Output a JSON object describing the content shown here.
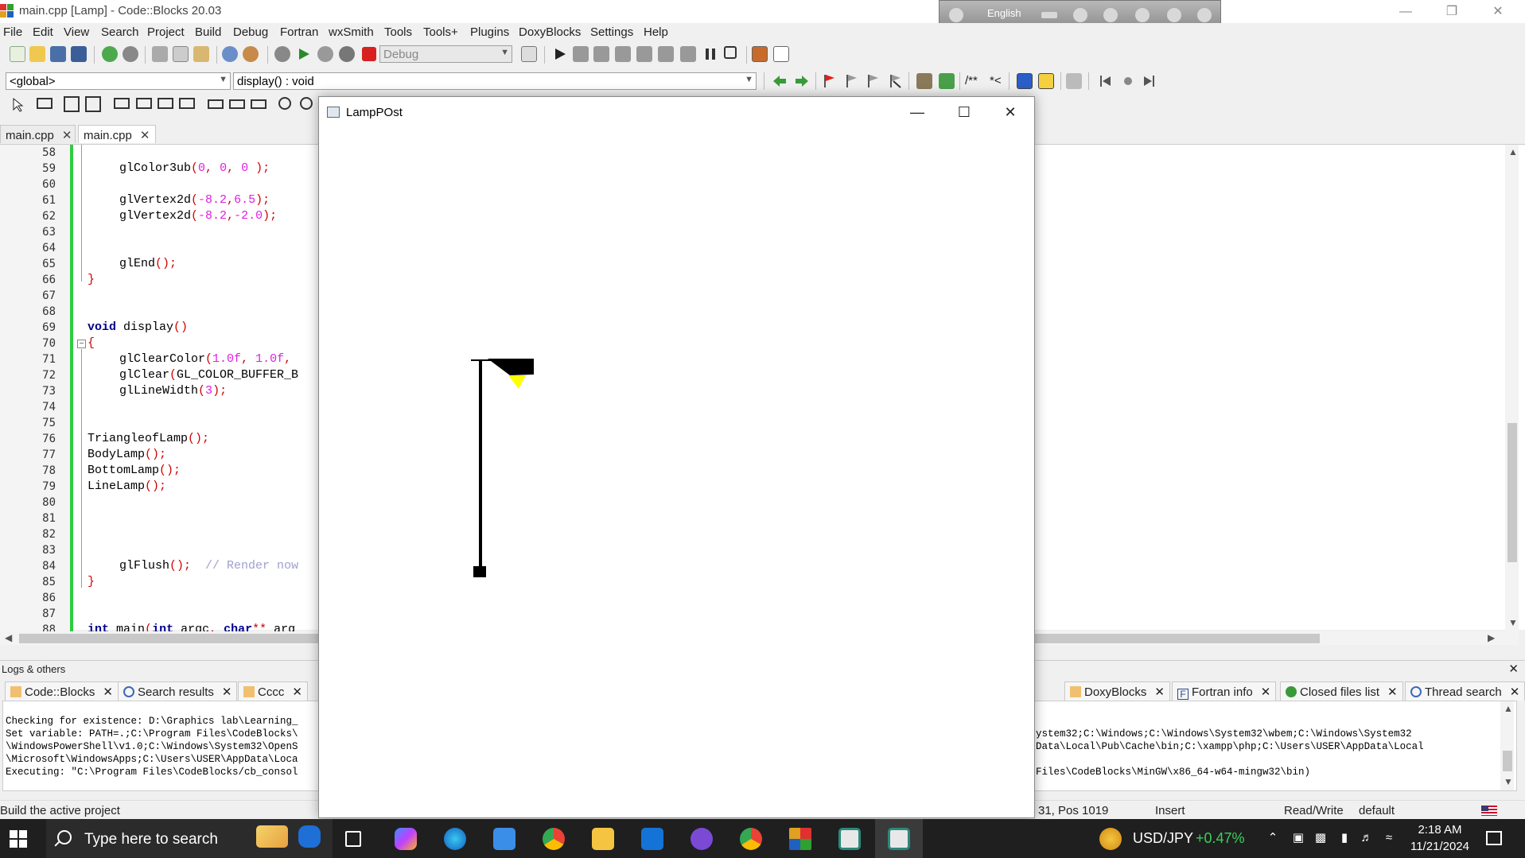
{
  "window": {
    "title": "main.cpp [Lamp] - Code::Blocks 20.03"
  },
  "language_bar": {
    "label": "English"
  },
  "menu": [
    "File",
    "Edit",
    "View",
    "Search",
    "Project",
    "Build",
    "Debug",
    "Fortran",
    "wxSmith",
    "Tools",
    "Tools+",
    "Plugins",
    "DoxyBlocks",
    "Settings",
    "Help"
  ],
  "toolbar": {
    "build_target": "Debug",
    "scope": "<global>",
    "function": "display() : void",
    "comment_btn": "/**",
    "comment_btn2": "*<"
  },
  "editor_tabs": [
    {
      "label": "main.cpp",
      "active": false
    },
    {
      "label": "main.cpp",
      "active": true
    }
  ],
  "editor": {
    "line_numbers": [
      "58",
      "59",
      "60",
      "61",
      "62",
      "63",
      "64",
      "65",
      "66",
      "67",
      "68",
      "69",
      "70",
      "71",
      "72",
      "73",
      "74",
      "75",
      "76",
      "77",
      "78",
      "79",
      "80",
      "81",
      "82",
      "83",
      "84",
      "85",
      "86",
      "87",
      "88"
    ],
    "code": {
      "l59": {
        "fn": "glColor3ub",
        "open": "(",
        "a": "0",
        "b": "0",
        "c": "0",
        "close": ");"
      },
      "l61": {
        "fn": "glVertex2d",
        "open": "(",
        "a": "-8.2",
        "b": "6.5",
        "close": ");"
      },
      "l62": {
        "fn": "glVertex2d",
        "open": "(",
        "a": "-8.2",
        "b": "-2.0",
        "close": ");"
      },
      "l65": {
        "fn": "glEnd",
        "paren": "();"
      },
      "l66": "}",
      "l69": {
        "kw": "void",
        "name": "display",
        "paren": "()"
      },
      "l70": "{",
      "l71": {
        "fn": "glClearColor",
        "open": "(",
        "a": "1.0f",
        "b": "1.0f"
      },
      "l72": {
        "fn": "glClear",
        "open": "(",
        "arg": "GL_COLOR_BUFFER_B"
      },
      "l73": {
        "fn": "glLineWidth",
        "open": "(",
        "a": "3",
        "close": ");"
      },
      "l76": {
        "fn": "TriangleofLamp",
        "paren": "();"
      },
      "l77": {
        "fn": "BodyLamp",
        "paren": "();"
      },
      "l78": {
        "fn": "BottomLamp",
        "paren": "();"
      },
      "l79": {
        "fn": "LineLamp",
        "paren": "();"
      },
      "l84": {
        "fn": "glFlush",
        "paren": "();",
        "comment": "// Render now"
      },
      "l85": "}",
      "l88": {
        "kw": "int",
        "name": "main",
        "open": "(",
        "kw2": "int",
        "arg": "argc",
        "kw3": "char",
        "ptr": "**",
        "rest": "arg"
      }
    }
  },
  "logs": {
    "title": "Logs & others",
    "tabs": [
      "Code::Blocks",
      "Search results",
      "Cccc",
      "DoxyBlocks",
      "Fortran info",
      "Closed files list",
      "Thread search"
    ],
    "lines_left": [
      "Checking for existence: D:\\Graphics lab\\Learning_",
      "Set variable: PATH=.;C:\\Program Files\\CodeBlocks\\",
      "\\WindowsPowerShell\\v1.0;C:\\Windows\\System32\\OpenS",
      "\\Microsoft\\WindowsApps;C:\\Users\\USER\\AppData\\Loca",
      "Executing: \"C:\\Program Files\\CodeBlocks/cb_consol"
    ],
    "lines_right": [
      "ystem32;C:\\Windows;C:\\Windows\\System32\\wbem;C:\\Windows\\System32",
      "Data\\Local\\Pub\\Cache\\bin;C:\\xampp\\php;C:\\Users\\USER\\AppData\\Local",
      "",
      "Files\\CodeBlocks\\MinGW\\x86_64-w64-mingw32\\bin)"
    ]
  },
  "statusbar": {
    "message": "Build the active project",
    "position": "31, Pos 1019",
    "mode": "Insert",
    "access": "Read/Write",
    "profile": "default"
  },
  "lamp_window": {
    "title": "LampPOst"
  },
  "taskbar": {
    "search_placeholder": "Type here to search",
    "ticker": "USD/JPY",
    "ticker_change": "+0.47%",
    "time": "2:18 AM",
    "date": "11/21/2024"
  },
  "colors": {
    "accent_green": "#2ecc40",
    "lamp_light": "#ffff00",
    "lamp_body": "#000000"
  }
}
